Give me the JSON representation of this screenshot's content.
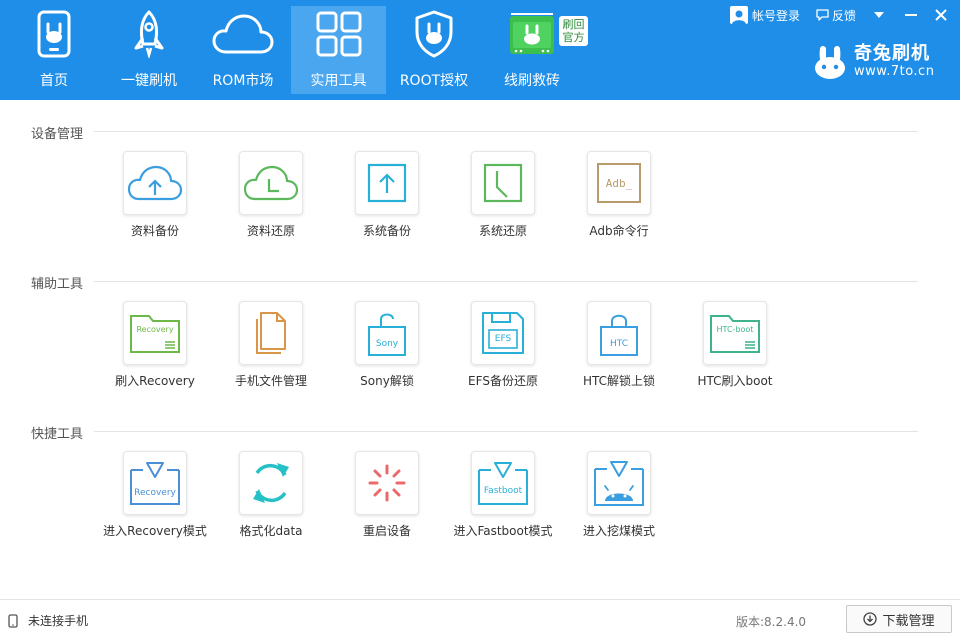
{
  "nav": {
    "items": [
      {
        "label": "首页",
        "icon": "phone-rabbit-icon"
      },
      {
        "label": "一键刷机",
        "icon": "rocket-icon"
      },
      {
        "label": "ROM市场",
        "icon": "cloud-icon"
      },
      {
        "label": "实用工具",
        "icon": "grid-icon",
        "active": true
      },
      {
        "label": "ROOT授权",
        "icon": "shield-rabbit-icon"
      },
      {
        "label": "线刷救砖",
        "icon": "board-rabbit-icon"
      }
    ],
    "badge_line1": "刷回",
    "badge_line2": "官方"
  },
  "topbar": {
    "login_label": "帐号登录",
    "feedback_label": "反馈"
  },
  "brand": {
    "name": "奇兔刷机",
    "url": "www.7to.cn"
  },
  "sections": [
    {
      "title": "设备管理",
      "tools": [
        {
          "label": "资料备份",
          "icon": "cloud-upload-icon",
          "color": "#3a9ee0"
        },
        {
          "label": "资料还原",
          "icon": "cloud-clock-icon",
          "color": "#5cb85c"
        },
        {
          "label": "系统备份",
          "icon": "box-upload-icon",
          "color": "#29b0d8"
        },
        {
          "label": "系统还原",
          "icon": "box-clock-icon",
          "color": "#5cb85c"
        },
        {
          "label": "Adb命令行",
          "icon": "adb-terminal-icon",
          "color": "#b89b6a",
          "icon_text": "Adb_"
        }
      ]
    },
    {
      "title": "辅助工具",
      "tools": [
        {
          "label": "刷入Recovery",
          "icon": "folder-recovery-icon",
          "color": "#6cb94a",
          "icon_text": "Recovery"
        },
        {
          "label": "手机文件管理",
          "icon": "document-icon",
          "color": "#d9954a"
        },
        {
          "label": "Sony解锁",
          "icon": "lock-sony-icon",
          "color": "#29b0d8",
          "icon_text": "Sony"
        },
        {
          "label": "EFS备份还原",
          "icon": "floppy-efs-icon",
          "color": "#29b0d8",
          "icon_text": "EFS"
        },
        {
          "label": "HTC解锁上锁",
          "icon": "lock-htc-icon",
          "color": "#3a9ee0",
          "icon_text": "HTC"
        },
        {
          "label": "HTC刷入boot",
          "icon": "folder-htc-boot-icon",
          "color": "#3fb48c",
          "icon_text": "HTC-boot"
        }
      ]
    },
    {
      "title": "快捷工具",
      "tools": [
        {
          "label": "进入Recovery模式",
          "icon": "enter-recovery-icon",
          "color": "#4a90d9",
          "icon_text": "Recovery"
        },
        {
          "label": "格式化data",
          "icon": "refresh-icon",
          "color": "#26c0c7"
        },
        {
          "label": "重启设备",
          "icon": "spinner-icon",
          "color": "#e86a6a"
        },
        {
          "label": "进入Fastboot模式",
          "icon": "enter-fastboot-icon",
          "color": "#29b0d8",
          "icon_text": "Fastboot"
        },
        {
          "label": "进入挖煤模式",
          "icon": "android-download-icon",
          "color": "#3a9ee0"
        }
      ]
    }
  ],
  "footer": {
    "status": "未连接手机",
    "version": "版本:8.2.4.0",
    "download_label": "下载管理"
  },
  "colors": {
    "header_bg": "#1e8ee8",
    "nav_active_bg": "#4aa6ef"
  }
}
